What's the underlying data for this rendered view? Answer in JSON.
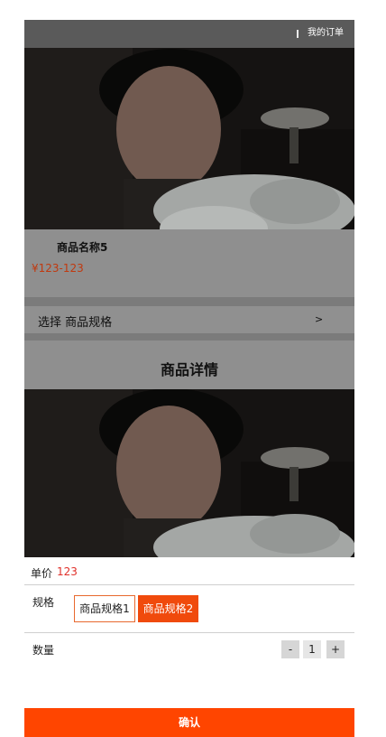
{
  "header": {
    "orders_link": "我的订单"
  },
  "product": {
    "name": "商品名称5",
    "price_range": "¥123-123"
  },
  "spec_selector": {
    "label": "选择 商品规格",
    "arrow": ">"
  },
  "details": {
    "title": "商品详情"
  },
  "purchase_sheet": {
    "unit_price_label": "单价",
    "unit_price_value": "123",
    "spec_label": "规格",
    "spec_options": [
      {
        "label": "商品规格1",
        "selected": false
      },
      {
        "label": "商品规格2",
        "selected": true
      }
    ],
    "quantity_label": "数量",
    "quantity_minus": "-",
    "quantity_value": "1",
    "quantity_plus": "+",
    "confirm_label": "确认"
  },
  "colors": {
    "accent": "#ff4500",
    "price": "#e0302a",
    "overlay": "#8f8f8f"
  }
}
